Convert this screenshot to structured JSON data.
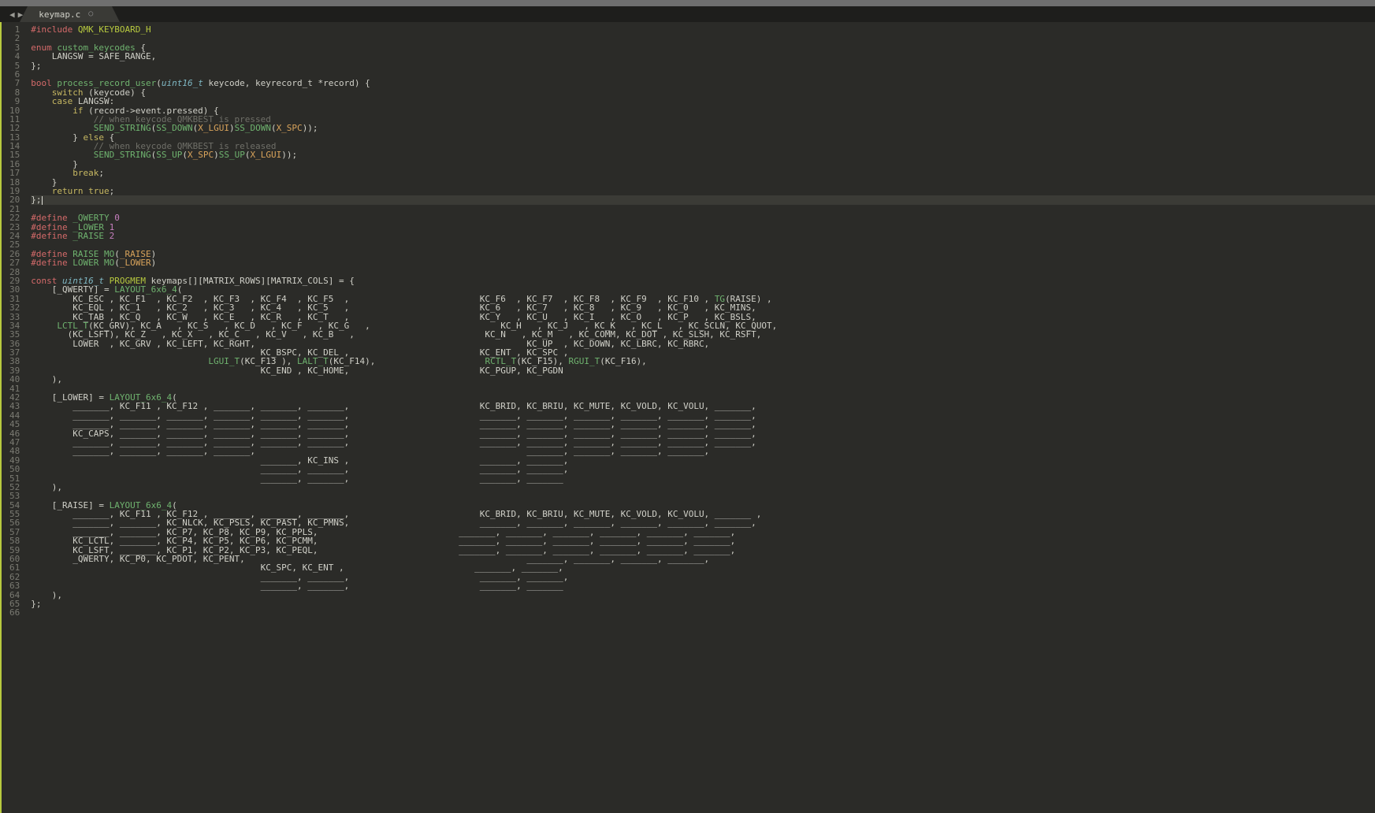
{
  "tab": {
    "filename": "keymap.c",
    "dirty_glyph": "○"
  },
  "nav": {
    "left": "◀",
    "right": "▶"
  },
  "gutter": {
    "start": 1,
    "end": 66,
    "current": 20
  },
  "code": {
    "lines": [
      {
        "n": 1,
        "seg": [
          [
            "k-pre",
            "#include"
          ],
          [
            "k-id",
            " "
          ],
          [
            "k-str",
            "QMK_KEYBOARD_H"
          ]
        ]
      },
      {
        "n": 2,
        "seg": [
          [
            "k-id",
            ""
          ]
        ]
      },
      {
        "n": 3,
        "seg": [
          [
            "k-pre",
            "enum"
          ],
          [
            "k-id",
            " "
          ],
          [
            "k-fn",
            "custom_keycodes"
          ],
          [
            "k-id",
            " {"
          ]
        ]
      },
      {
        "n": 4,
        "seg": [
          [
            "k-id",
            "    LANGSW = SAFE_RANGE,"
          ]
        ]
      },
      {
        "n": 5,
        "seg": [
          [
            "k-id",
            "};"
          ]
        ]
      },
      {
        "n": 6,
        "seg": [
          [
            "k-id",
            ""
          ]
        ]
      },
      {
        "n": 7,
        "seg": [
          [
            "k-pre",
            "bool"
          ],
          [
            "k-id",
            " "
          ],
          [
            "k-fn",
            "process_record_user"
          ],
          [
            "k-id",
            "("
          ],
          [
            "k-type",
            "uint16_t"
          ],
          [
            "k-id",
            " keycode, keyrecord_t *record) {"
          ]
        ]
      },
      {
        "n": 8,
        "seg": [
          [
            "k-id",
            "    "
          ],
          [
            "k-kw",
            "switch"
          ],
          [
            "k-id",
            " (keycode) {"
          ]
        ]
      },
      {
        "n": 9,
        "seg": [
          [
            "k-id",
            "    "
          ],
          [
            "k-kw",
            "case"
          ],
          [
            "k-id",
            " LANGSW:"
          ]
        ]
      },
      {
        "n": 10,
        "seg": [
          [
            "k-id",
            "        "
          ],
          [
            "k-kw",
            "if"
          ],
          [
            "k-id",
            " (record->event.pressed) {"
          ]
        ]
      },
      {
        "n": 11,
        "seg": [
          [
            "k-id",
            "            "
          ],
          [
            "k-com",
            "// when keycode QMKBEST is pressed"
          ]
        ]
      },
      {
        "n": 12,
        "seg": [
          [
            "k-id",
            "            "
          ],
          [
            "k-mac",
            "SEND_STRING"
          ],
          [
            "k-id",
            "("
          ],
          [
            "k-mac",
            "SS_DOWN"
          ],
          [
            "k-id",
            "("
          ],
          [
            "k-arg",
            "X_LGUI"
          ],
          [
            "k-id",
            ")"
          ],
          [
            "k-mac",
            "SS_DOWN"
          ],
          [
            "k-id",
            "("
          ],
          [
            "k-arg",
            "X_SPC"
          ],
          [
            "k-id",
            "));"
          ]
        ]
      },
      {
        "n": 13,
        "seg": [
          [
            "k-id",
            "        } "
          ],
          [
            "k-kw",
            "else"
          ],
          [
            "k-id",
            " {"
          ]
        ]
      },
      {
        "n": 14,
        "seg": [
          [
            "k-id",
            "            "
          ],
          [
            "k-com",
            "// when keycode QMKBEST is released"
          ]
        ]
      },
      {
        "n": 15,
        "seg": [
          [
            "k-id",
            "            "
          ],
          [
            "k-mac",
            "SEND_STRING"
          ],
          [
            "k-id",
            "("
          ],
          [
            "k-mac",
            "SS_UP"
          ],
          [
            "k-id",
            "("
          ],
          [
            "k-arg",
            "X_SPC"
          ],
          [
            "k-id",
            ")"
          ],
          [
            "k-mac",
            "SS_UP"
          ],
          [
            "k-id",
            "("
          ],
          [
            "k-arg",
            "X_LGUI"
          ],
          [
            "k-id",
            "));"
          ]
        ]
      },
      {
        "n": 16,
        "seg": [
          [
            "k-id",
            "        }"
          ]
        ]
      },
      {
        "n": 17,
        "seg": [
          [
            "k-id",
            "        "
          ],
          [
            "k-kw",
            "break"
          ],
          [
            "k-id",
            ";"
          ]
        ]
      },
      {
        "n": 18,
        "seg": [
          [
            "k-id",
            "    }"
          ]
        ]
      },
      {
        "n": 19,
        "seg": [
          [
            "k-id",
            "    "
          ],
          [
            "k-kw",
            "return"
          ],
          [
            "k-id",
            " "
          ],
          [
            "k-kw",
            "true"
          ],
          [
            "k-id",
            ";"
          ]
        ]
      },
      {
        "n": 20,
        "seg": [
          [
            "k-id",
            "};"
          ]
        ],
        "current": true,
        "caret": true
      },
      {
        "n": 21,
        "seg": [
          [
            "k-id",
            ""
          ]
        ]
      },
      {
        "n": 22,
        "seg": [
          [
            "k-pre",
            "#define"
          ],
          [
            "k-id",
            " "
          ],
          [
            "k-fn",
            "_QWERTY"
          ],
          [
            "k-id",
            " "
          ],
          [
            "k-num",
            "0"
          ]
        ]
      },
      {
        "n": 23,
        "seg": [
          [
            "k-pre",
            "#define"
          ],
          [
            "k-id",
            " "
          ],
          [
            "k-fn",
            "_LOWER"
          ],
          [
            "k-id",
            " "
          ],
          [
            "k-num",
            "1"
          ]
        ]
      },
      {
        "n": 24,
        "seg": [
          [
            "k-pre",
            "#define"
          ],
          [
            "k-id",
            " "
          ],
          [
            "k-fn",
            "_RAISE"
          ],
          [
            "k-id",
            " "
          ],
          [
            "k-num",
            "2"
          ]
        ]
      },
      {
        "n": 25,
        "seg": [
          [
            "k-id",
            ""
          ]
        ]
      },
      {
        "n": 26,
        "seg": [
          [
            "k-pre",
            "#define"
          ],
          [
            "k-id",
            " "
          ],
          [
            "k-fn",
            "RAISE"
          ],
          [
            "k-id",
            " "
          ],
          [
            "k-lay",
            "MO"
          ],
          [
            "k-id",
            "("
          ],
          [
            "k-arg",
            "_RAISE"
          ],
          [
            "k-id",
            ")"
          ]
        ]
      },
      {
        "n": 27,
        "seg": [
          [
            "k-pre",
            "#define"
          ],
          [
            "k-id",
            " "
          ],
          [
            "k-fn",
            "LOWER"
          ],
          [
            "k-id",
            " "
          ],
          [
            "k-lay",
            "MO"
          ],
          [
            "k-id",
            "("
          ],
          [
            "k-arg",
            "_LOWER"
          ],
          [
            "k-id",
            ")"
          ]
        ]
      },
      {
        "n": 28,
        "seg": [
          [
            "k-id",
            ""
          ]
        ]
      },
      {
        "n": 29,
        "seg": [
          [
            "k-pre",
            "const"
          ],
          [
            "k-id",
            " "
          ],
          [
            "k-type",
            "uint16_t"
          ],
          [
            "k-id",
            " "
          ],
          [
            "k-str",
            "PROGMEM"
          ],
          [
            "k-id",
            " keymaps[][MATRIX_ROWS][MATRIX_COLS] = {"
          ]
        ]
      },
      {
        "n": 30,
        "seg": [
          [
            "k-id",
            "    [_QWERTY] = "
          ],
          [
            "k-lay",
            "LAYOUT_6x6_4"
          ],
          [
            "k-id",
            "("
          ]
        ]
      },
      {
        "n": 31,
        "seg": [
          [
            "k-id",
            "        KC_ESC , KC_F1  , KC_F2  , KC_F3  , KC_F4  , KC_F5  ,                         KC_F6  , KC_F7  , KC_F8  , KC_F9  , KC_F10 , "
          ],
          [
            "k-lay",
            "TG"
          ],
          [
            "k-id",
            "(RAISE) ,"
          ]
        ]
      },
      {
        "n": 32,
        "seg": [
          [
            "k-id",
            "        KC_EQL , KC_1   , KC_2   , KC_3   , KC_4   , KC_5   ,                         KC_6   , KC_7   , KC_8   , KC_9   , KC_0   , KC_MINS,"
          ]
        ]
      },
      {
        "n": 33,
        "seg": [
          [
            "k-id",
            "        KC_TAB , KC_Q   , KC_W   , KC_E   , KC_R   , KC_T   ,                         KC_Y   , KC_U   , KC_I   , KC_O   , KC_P   , KC_BSLS,"
          ]
        ]
      },
      {
        "n": 34,
        "seg": [
          [
            "k-id",
            "     "
          ],
          [
            "k-lay",
            "LCTL_T"
          ],
          [
            "k-id",
            "(KC_GRV), KC_A   , KC_S   , KC_D   , KC_F   , KC_G   ,                         KC_H   , KC_J   , KC_K   , KC_L   , KC_SCLN, KC_QUOT,"
          ]
        ]
      },
      {
        "n": 35,
        "seg": [
          [
            "k-id",
            "       (KC_LSFT), KC_Z   , KC_X   , KC_C   , KC_V   , KC_B   ,                         KC_N   , KC_M   , KC_COMM, KC_DOT , KC_SLSH, KC_RSFT,"
          ]
        ]
      },
      {
        "n": 36,
        "seg": [
          [
            "k-id",
            "        LOWER  , KC_GRV , KC_LEFT, KC_RGHT,                                                    KC_UP  , KC_DOWN, KC_LBRC, KC_RBRC,"
          ]
        ]
      },
      {
        "n": 37,
        "seg": [
          [
            "k-id",
            "                                            KC_BSPC, KC_DEL ,                         KC_ENT , KC_SPC ,"
          ]
        ]
      },
      {
        "n": 38,
        "seg": [
          [
            "k-id",
            "                                  "
          ],
          [
            "k-lay",
            "LGUI_T"
          ],
          [
            "k-id",
            "(KC_F13 ), "
          ],
          [
            "k-lay",
            "LALT_T"
          ],
          [
            "k-id",
            "(KC_F14),                     "
          ],
          [
            "k-lay",
            "RCTL_T"
          ],
          [
            "k-id",
            "(KC_F15), "
          ],
          [
            "k-lay",
            "RGUI_T"
          ],
          [
            "k-id",
            "(KC_F16),"
          ]
        ]
      },
      {
        "n": 39,
        "seg": [
          [
            "k-id",
            "                                            KC_END , KC_HOME,                         KC_PGUP, KC_PGDN"
          ]
        ]
      },
      {
        "n": 40,
        "seg": [
          [
            "k-id",
            "    ),"
          ]
        ]
      },
      {
        "n": 41,
        "seg": [
          [
            "k-id",
            ""
          ]
        ]
      },
      {
        "n": 42,
        "seg": [
          [
            "k-id",
            "    [_LOWER] = "
          ],
          [
            "k-lay",
            "LAYOUT_6x6_4"
          ],
          [
            "k-id",
            "("
          ]
        ]
      },
      {
        "n": 43,
        "seg": [
          [
            "k-id",
            "        _______, KC_F11 , KC_F12 , _______, _______, _______,                         KC_BRID, KC_BRIU, KC_MUTE, KC_VOLD, KC_VOLU, _______,"
          ]
        ]
      },
      {
        "n": 44,
        "seg": [
          [
            "k-id",
            "        _______, _______, _______, _______, _______, _______,                         _______, _______, _______, _______, _______, _______,"
          ]
        ]
      },
      {
        "n": 45,
        "seg": [
          [
            "k-id",
            "        _______, _______, _______, _______, _______, _______,                         _______, _______, _______, _______, _______, _______,"
          ]
        ]
      },
      {
        "n": 46,
        "seg": [
          [
            "k-id",
            "        KC_CAPS, _______, _______, _______, _______, _______,                         _______, _______, _______, _______, _______, _______,"
          ]
        ]
      },
      {
        "n": 47,
        "seg": [
          [
            "k-id",
            "        _______, _______, _______, _______, _______, _______,                         _______, _______, _______, _______, _______, _______,"
          ]
        ]
      },
      {
        "n": 48,
        "seg": [
          [
            "k-id",
            "        _______, _______, _______, _______,                                                    _______, _______, _______, _______,"
          ]
        ]
      },
      {
        "n": 49,
        "seg": [
          [
            "k-id",
            "                                            _______, KC_INS ,                         _______, _______,"
          ]
        ]
      },
      {
        "n": 50,
        "seg": [
          [
            "k-id",
            "                                            _______, _______,                         _______, _______,"
          ]
        ]
      },
      {
        "n": 51,
        "seg": [
          [
            "k-id",
            "                                            _______, _______,                         _______, _______"
          ]
        ]
      },
      {
        "n": 52,
        "seg": [
          [
            "k-id",
            "    ),"
          ]
        ]
      },
      {
        "n": 53,
        "seg": [
          [
            "k-id",
            ""
          ]
        ]
      },
      {
        "n": 54,
        "seg": [
          [
            "k-id",
            "    [_RAISE] = "
          ],
          [
            "k-lay",
            "LAYOUT_6x6_4"
          ],
          [
            "k-id",
            "("
          ]
        ]
      },
      {
        "n": 55,
        "seg": [
          [
            "k-id",
            "        _______, KC_F11 , KC_F12 , _______, _______, _______,                         KC_BRID, KC_BRIU, KC_MUTE, KC_VOLD, KC_VOLU, _______ ,"
          ]
        ]
      },
      {
        "n": 56,
        "seg": [
          [
            "k-id",
            "        _______, _______, KC_NLCK, KC_PSLS, KC_PAST, KC_PMNS,                         _______, _______, _______, _______, _______, _______,"
          ]
        ]
      },
      {
        "n": 57,
        "seg": [
          [
            "k-id",
            "        _______, _______, KC_P7, KC_P8, KC_P9, KC_PPLS,                           _______, _______, _______, _______, _______, _______,"
          ]
        ]
      },
      {
        "n": 58,
        "seg": [
          [
            "k-id",
            "        KC_LCTL, _______, KC_P4, KC_P5, KC_P6, KC_PCMM,                           _______, _______, _______, _______, _______, _______,"
          ]
        ]
      },
      {
        "n": 59,
        "seg": [
          [
            "k-id",
            "        KC_LSFT, _______, KC_P1, KC_P2, KC_P3, KC_PEQL,                           _______, _______, _______, _______, _______, _______,"
          ]
        ]
      },
      {
        "n": 60,
        "seg": [
          [
            "k-id",
            "        _QWERTY, KC_P0, KC_PDOT, KC_PENT,                                                      _______, _______, _______, _______,"
          ]
        ]
      },
      {
        "n": 61,
        "seg": [
          [
            "k-id",
            "                                            KC_SPC, KC_ENT ,                         _______, _______,"
          ]
        ]
      },
      {
        "n": 62,
        "seg": [
          [
            "k-id",
            "                                            _______, _______,                         _______, _______,"
          ]
        ]
      },
      {
        "n": 63,
        "seg": [
          [
            "k-id",
            "                                            _______, _______,                         _______, _______"
          ]
        ]
      },
      {
        "n": 64,
        "seg": [
          [
            "k-id",
            "    ),"
          ]
        ]
      },
      {
        "n": 65,
        "seg": [
          [
            "k-id",
            "};"
          ]
        ]
      },
      {
        "n": 66,
        "seg": [
          [
            "k-id",
            ""
          ]
        ]
      }
    ]
  }
}
